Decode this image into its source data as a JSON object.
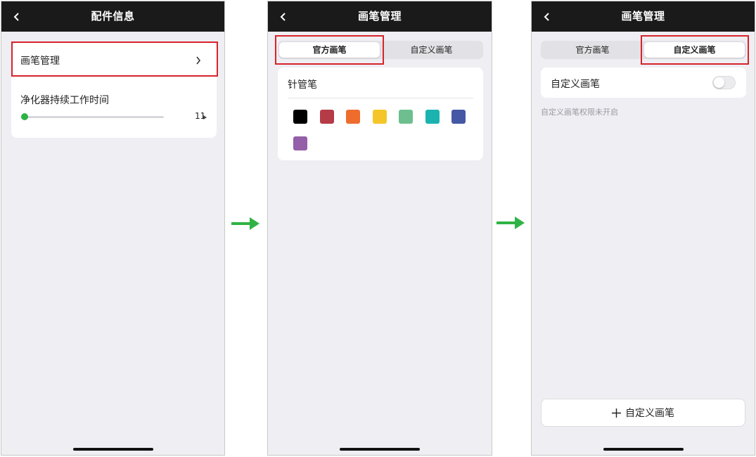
{
  "screen1": {
    "title": "配件信息",
    "pen_management_label": "画笔管理",
    "purifier_label": "净化器持续工作时间",
    "slider_value_label": "11",
    "slider_value": 0,
    "colors": {
      "slider_knob": "#2fb344",
      "track": "#d7d7dc",
      "highlight": "#d8232a"
    }
  },
  "screen2": {
    "title": "画笔管理",
    "tabs": [
      {
        "label": "官方画笔",
        "active": true
      },
      {
        "label": "自定义画笔",
        "active": false
      }
    ],
    "section_title": "针管笔",
    "pen_colors": [
      "#000000",
      "#b53b47",
      "#ee6d2d",
      "#f4c62a",
      "#6dbf8f",
      "#1ab3b0",
      "#4558a6",
      "#945ea8"
    ]
  },
  "screen3": {
    "title": "画笔管理",
    "tabs": [
      {
        "label": "官方画笔",
        "active": false
      },
      {
        "label": "自定义画笔",
        "active": true
      }
    ],
    "toggle_label": "自定义画笔",
    "toggle_on": false,
    "hint_text": "自定义画笔权限未开启",
    "add_button_label": "自定义画笔",
    "add_icon": "plus-icon"
  },
  "arrows": {
    "color": "#2fb344",
    "icon": "arrow-right-icon"
  }
}
